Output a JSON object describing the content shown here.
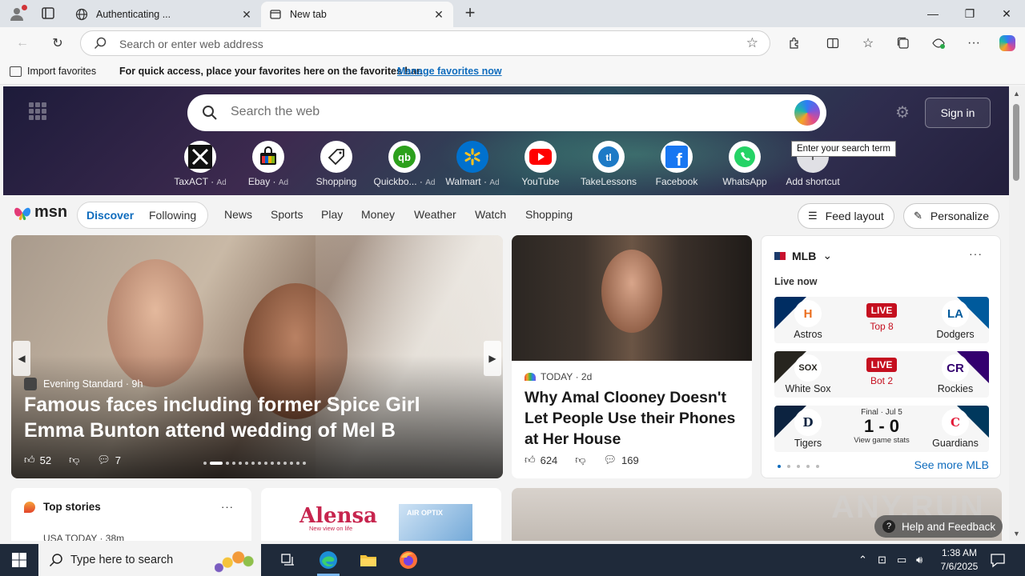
{
  "browser": {
    "tabs": [
      {
        "label": "Authenticating ...",
        "active": false
      },
      {
        "label": "New tab",
        "active": true
      }
    ],
    "address_placeholder": "Search or enter web address"
  },
  "favorites_bar": {
    "import_label": "Import favorites",
    "message": "For quick access, place your favorites here on the favorites bar.",
    "manage_link": "Manage favorites now"
  },
  "newtab": {
    "search_placeholder": "Search the web",
    "sign_in": "Sign in",
    "tooltip": "Enter your search term",
    "shortcuts": [
      {
        "label": "TaxACT",
        "ad": "Ad",
        "icon": "taxact-icon"
      },
      {
        "label": "Ebay",
        "ad": "Ad",
        "icon": "ebay-icon"
      },
      {
        "label": "Shopping",
        "ad": "",
        "icon": "shopping-tag-icon"
      },
      {
        "label": "Quickbo...",
        "ad": "Ad",
        "icon": "quickbooks-icon"
      },
      {
        "label": "Walmart",
        "ad": "Ad",
        "icon": "walmart-icon"
      },
      {
        "label": "YouTube",
        "ad": "",
        "icon": "youtube-icon"
      },
      {
        "label": "TakeLessons",
        "ad": "",
        "icon": "takelessons-icon"
      },
      {
        "label": "Facebook",
        "ad": "",
        "icon": "facebook-icon"
      },
      {
        "label": "WhatsApp",
        "ad": "",
        "icon": "whatsapp-icon"
      },
      {
        "label": "Add shortcut",
        "ad": "",
        "icon": "add-icon"
      }
    ]
  },
  "msn": {
    "logo": "msn",
    "tabs": [
      "Discover",
      "Following"
    ],
    "nav": [
      "News",
      "Sports",
      "Play",
      "Money",
      "Weather",
      "Watch",
      "Shopping"
    ],
    "feed_layout": "Feed layout",
    "personalize": "Personalize"
  },
  "hero_story": {
    "source": "Evening Standard",
    "age": "9h",
    "title": "Famous faces including former Spice Girl Emma Bunton attend wedding of Mel B",
    "likes": "52",
    "comments": "7"
  },
  "side_story": {
    "source": "TODAY",
    "age": "2d",
    "title": "Why Amal Clooney Doesn't Let People Use their Phones at Her House",
    "likes": "624",
    "comments": "169"
  },
  "mlb": {
    "title": "MLB",
    "live_now": "Live now",
    "games": [
      {
        "home": "Astros",
        "away": "Dodgers",
        "status": "LIVE",
        "detail": "Top 8",
        "home_color": "#002d62",
        "away_color": "#005a9c",
        "home_mark": "H",
        "away_mark": "LA"
      },
      {
        "home": "White Sox",
        "away": "Rockies",
        "status": "LIVE",
        "detail": "Bot 2",
        "home_color": "#27251f",
        "away_color": "#33006f",
        "home_mark": "SOX",
        "away_mark": "CR"
      },
      {
        "home": "Tigers",
        "away": "Guardians",
        "status": "Final · Jul 5",
        "score": "1 - 0",
        "detail": "View game stats",
        "home_color": "#0c2340",
        "away_color": "#00385d",
        "home_mark": "D",
        "away_mark": "C"
      }
    ],
    "see_more": "See more MLB"
  },
  "top_stories": {
    "title": "Top stories",
    "first_source": "USA TODAY · 38m"
  },
  "ad_card": {
    "brand": "Alensa",
    "tagline": "New view on life",
    "product": "AIR OPTIX"
  },
  "help_feedback": "Help and Feedback",
  "watermark": "ANY.RUN",
  "taskbar": {
    "search_placeholder": "Type here to search",
    "time": "1:38 AM",
    "date": "7/6/2025"
  }
}
